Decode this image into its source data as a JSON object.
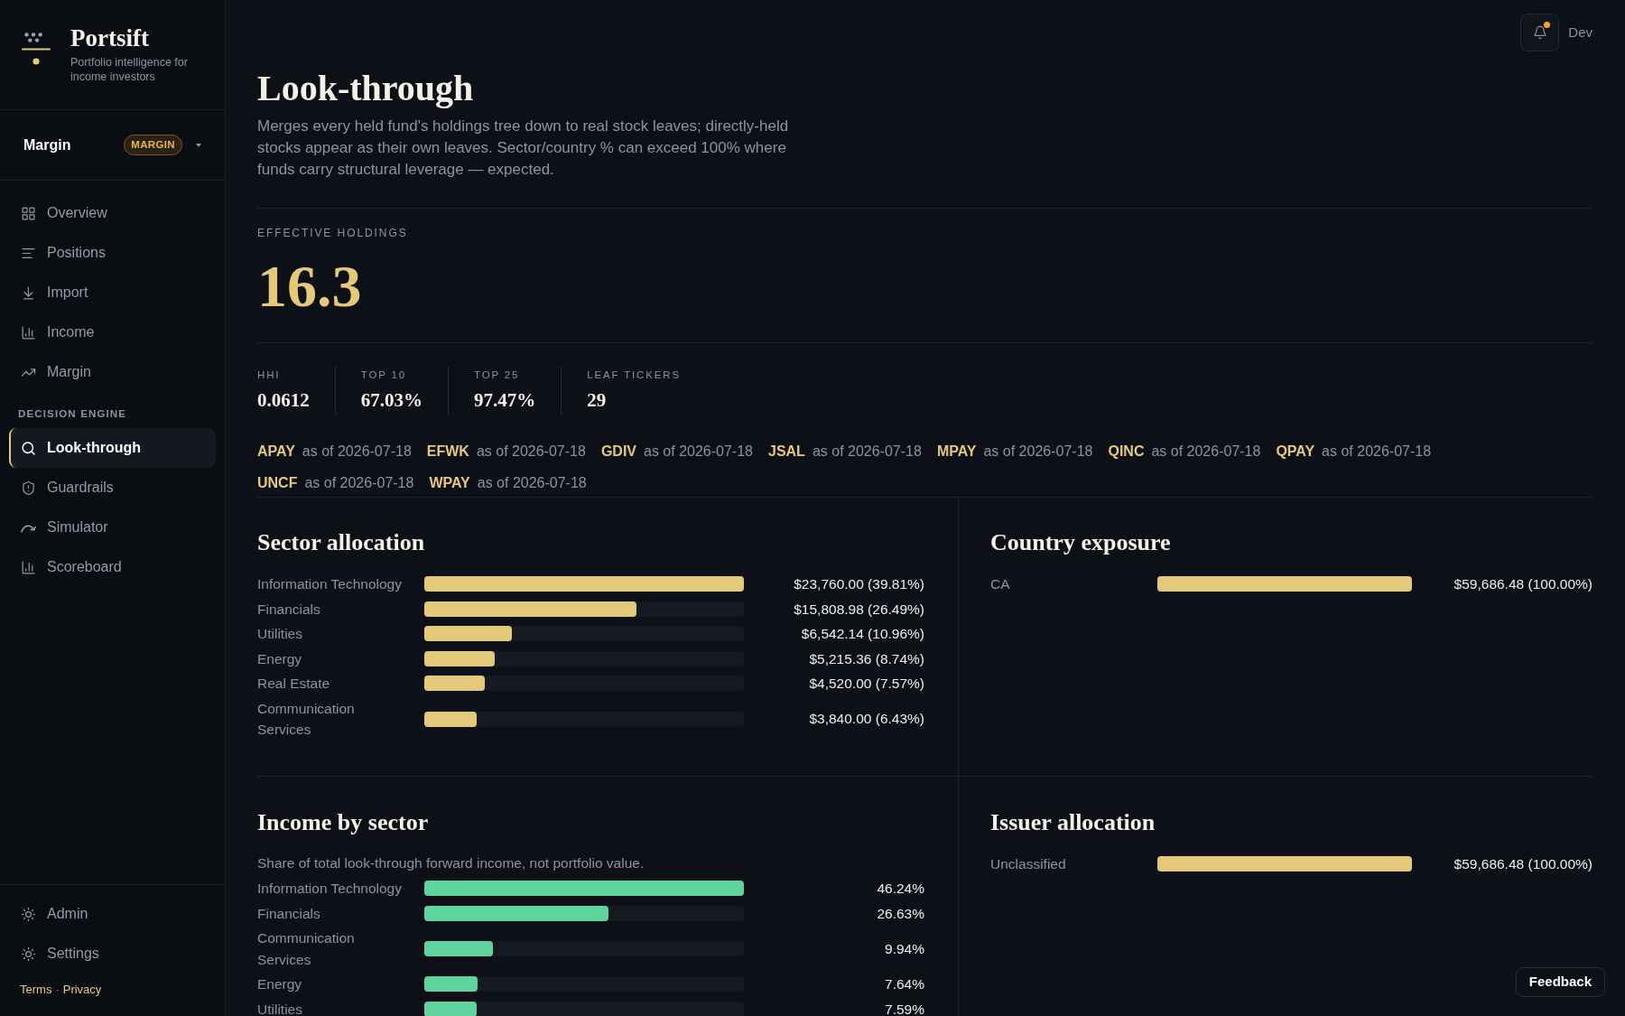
{
  "brand": {
    "name": "Portsift",
    "tagline": "Portfolio intelligence for income investors"
  },
  "account": {
    "name": "Margin",
    "badge": "MARGIN"
  },
  "nav": {
    "main": [
      {
        "label": "Overview",
        "selected": false
      },
      {
        "label": "Positions",
        "selected": false
      },
      {
        "label": "Import",
        "selected": false
      },
      {
        "label": "Income",
        "selected": false
      },
      {
        "label": "Margin",
        "selected": false
      }
    ],
    "section_label": "DECISION ENGINE",
    "decision": [
      {
        "label": "Look-through",
        "selected": true
      },
      {
        "label": "Guardrails",
        "selected": false
      },
      {
        "label": "Simulator",
        "selected": false
      },
      {
        "label": "Scoreboard",
        "selected": false
      }
    ],
    "footer": [
      {
        "label": "Admin",
        "selected": false
      },
      {
        "label": "Settings",
        "selected": false
      }
    ]
  },
  "legal": {
    "links": [
      "Terms",
      "Privacy"
    ],
    "separator": "·"
  },
  "topbar": {
    "notifications": {
      "unread": true
    },
    "user": "Dev"
  },
  "page": {
    "title": "Look-through",
    "description": "Merges every held fund's holdings tree down to real stock leaves; directly-held stocks appear as their own leaves. Sector/country % can exceed 100% where funds carry structural leverage — expected."
  },
  "effective_holdings": {
    "label": "EFFECTIVE HOLDINGS",
    "value": "16.3"
  },
  "stats": [
    {
      "label": "HHI",
      "value": "0.0612"
    },
    {
      "label": "TOP 10",
      "value": "67.03%"
    },
    {
      "label": "TOP 25",
      "value": "97.47%"
    },
    {
      "label": "LEAF TICKERS",
      "value": "29"
    }
  ],
  "tickers": [
    {
      "symbol": "APAY",
      "as_of": "as of 2026-07-18"
    },
    {
      "symbol": "EFWK",
      "as_of": "as of 2026-07-18"
    },
    {
      "symbol": "GDIV",
      "as_of": "as of 2026-07-18"
    },
    {
      "symbol": "JSAL",
      "as_of": "as of 2026-07-18"
    },
    {
      "symbol": "MPAY",
      "as_of": "as of 2026-07-18"
    },
    {
      "symbol": "QINC",
      "as_of": "as of 2026-07-18"
    },
    {
      "symbol": "QPAY",
      "as_of": "as of 2026-07-18"
    },
    {
      "symbol": "UNCF",
      "as_of": "as of 2026-07-18"
    },
    {
      "symbol": "WPAY",
      "as_of": "as of 2026-07-18"
    }
  ],
  "panels": [
    {
      "title": "Sector allocation",
      "color": "#e5c97a",
      "rows": [
        {
          "label": "Information Technology",
          "level": 1,
          "reading": "$23,760.00 (39.81%)"
        },
        {
          "label": "Financials",
          "level": 0.665,
          "reading": "$15,808.98 (26.49%)"
        },
        {
          "label": "Utilities",
          "level": 0.275,
          "reading": "$6,542.14 (10.96%)"
        },
        {
          "label": "Energy",
          "level": 0.219,
          "reading": "$5,215.36 (8.74%)"
        },
        {
          "label": "Real Estate",
          "level": 0.19,
          "reading": "$4,520.00 (7.57%)"
        },
        {
          "label": "Communication Services",
          "level": 0.163,
          "reading": "$3,840.00 (6.43%)"
        }
      ]
    },
    {
      "title": "Country exposure",
      "color": "#e5c97a",
      "rows": [
        {
          "label": "CA",
          "level": 1,
          "reading": "$59,686.48 (100.00%)"
        }
      ]
    },
    {
      "title": "Income by sector",
      "color": "#5fd49e",
      "subtitle": "Share of total look-through forward income, not portfolio value.",
      "rows": [
        {
          "label": "Information Technology",
          "level": 1,
          "reading": "46.24%"
        },
        {
          "label": "Financials",
          "level": 0.577,
          "reading": "26.63%"
        },
        {
          "label": "Communication Services",
          "level": 0.214,
          "reading": "9.94%"
        },
        {
          "label": "Energy",
          "level": 0.166,
          "reading": "7.64%"
        },
        {
          "label": "Utilities",
          "level": 0.165,
          "reading": "7.59%"
        }
      ]
    },
    {
      "title": "Issuer allocation",
      "color": "#e5c97a",
      "rows": [
        {
          "label": "Unclassified",
          "level": 1,
          "reading": "$59,686.48 (100.00%)"
        }
      ]
    }
  ],
  "feedback_button": "Feedback"
}
